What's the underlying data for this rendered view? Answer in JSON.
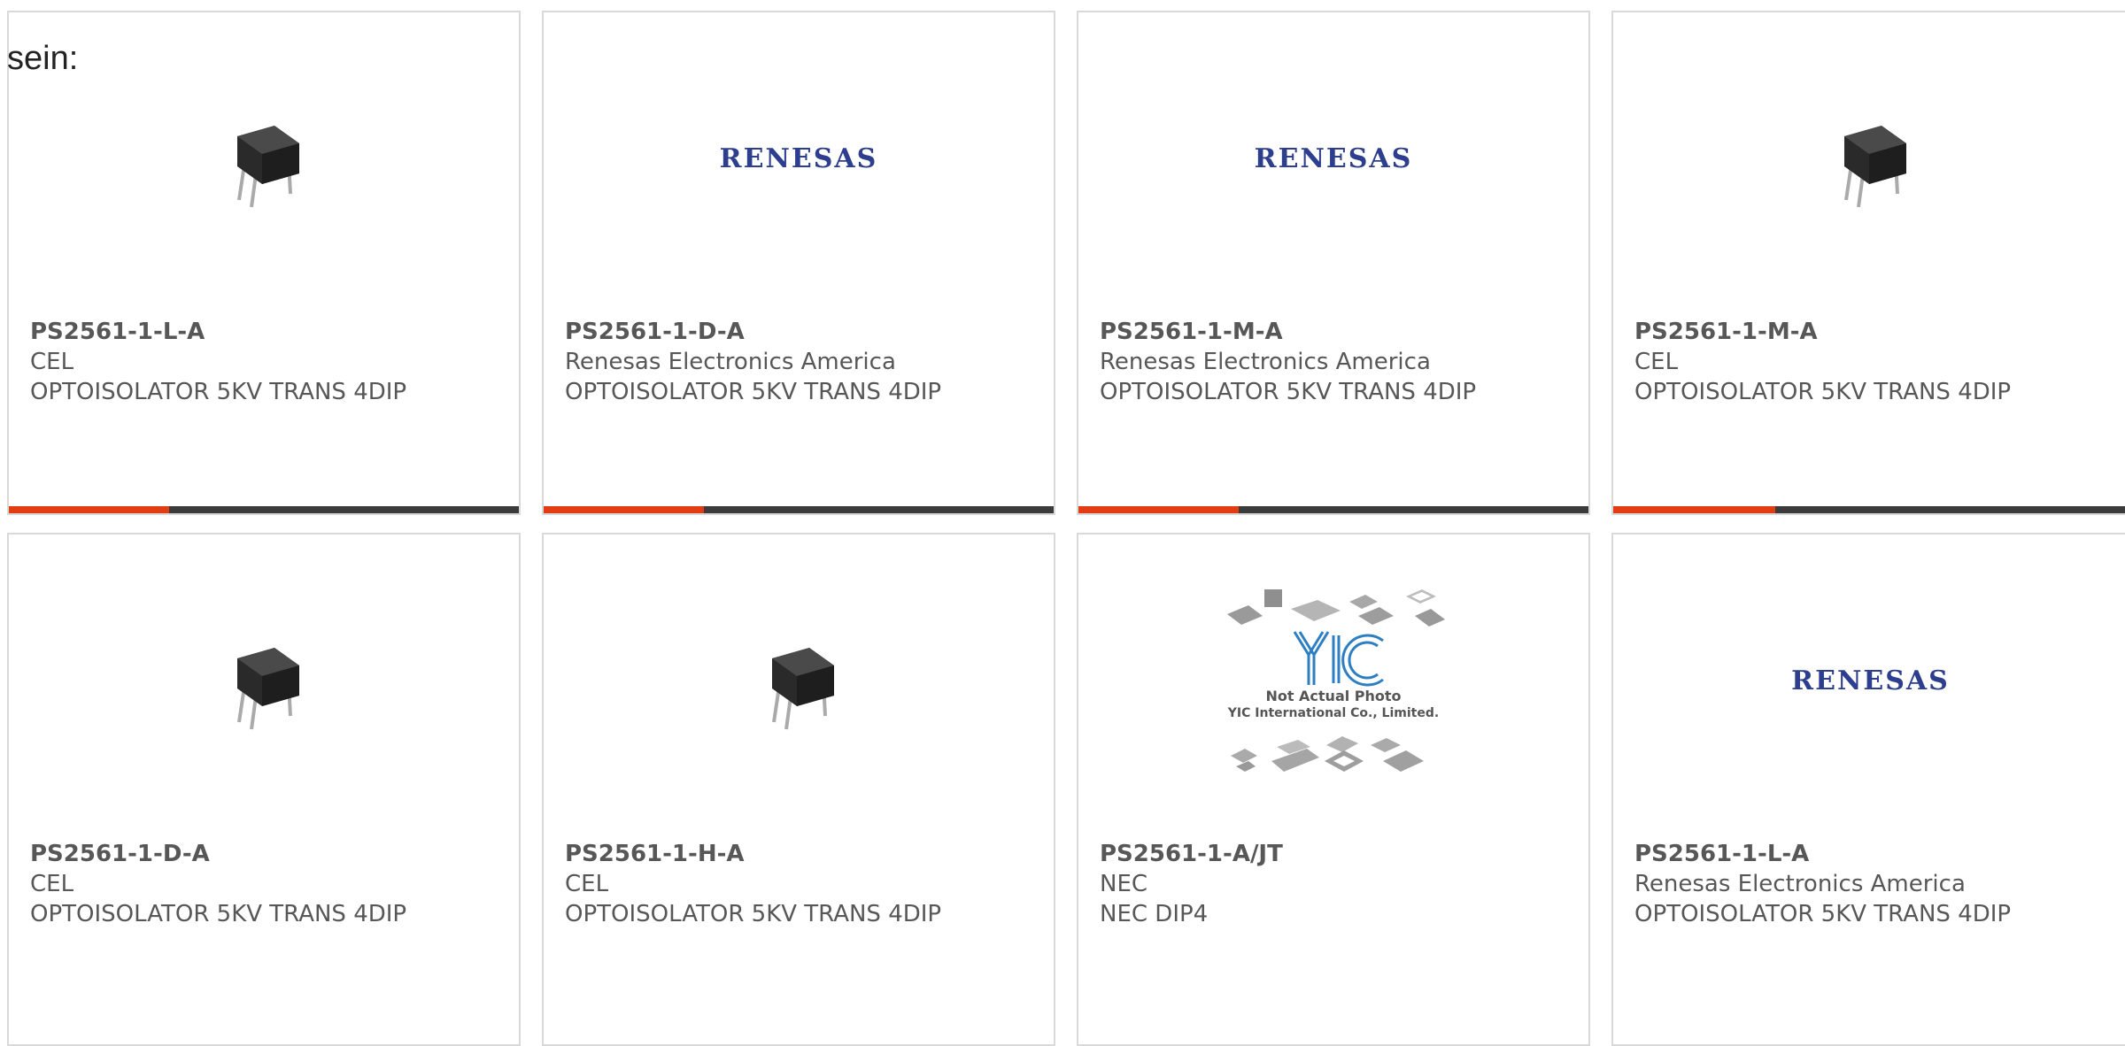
{
  "heading": "sein:",
  "colors": {
    "accent": "#e23d12",
    "bar": "#3b3b3b",
    "renesas_blue": "#2d3e8e",
    "text": "#575757"
  },
  "products": [
    {
      "part_number": "PS2561-1-L-A",
      "manufacturer": "CEL",
      "description": "OPTOISOLATOR 5KV TRANS 4DIP",
      "image": "chip-photo",
      "accent_fraction": 0.315
    },
    {
      "part_number": "PS2561-1-D-A",
      "manufacturer": "Renesas Electronics America",
      "description": "OPTOISOLATOR 5KV TRANS 4DIP",
      "image": "renesas-logo",
      "logo_text": "RENESAS",
      "accent_fraction": 0.315
    },
    {
      "part_number": "PS2561-1-M-A",
      "manufacturer": "Renesas Electronics America",
      "description": "OPTOISOLATOR 5KV TRANS 4DIP",
      "image": "renesas-logo",
      "logo_text": "RENESAS",
      "accent_fraction": 0.315
    },
    {
      "part_number": "PS2561-1-M-A",
      "manufacturer": "CEL",
      "description": "OPTOISOLATOR 5KV TRANS 4DIP",
      "image": "chip-photo",
      "accent_fraction": 0.315
    },
    {
      "part_number": "PS2561-1-D-A",
      "manufacturer": "CEL",
      "description": "OPTOISOLATOR 5KV TRANS 4DIP",
      "image": "chip-photo"
    },
    {
      "part_number": "PS2561-1-H-A",
      "manufacturer": "CEL",
      "description": "OPTOISOLATOR 5KV TRANS 4DIP",
      "image": "chip-photo"
    },
    {
      "part_number": "PS2561-1-A/JT",
      "manufacturer": "NEC",
      "description": "NEC DIP4",
      "image": "not-actual-photo",
      "photo_caption_line1": "Not Actual Photo",
      "photo_caption_line2": "YIC International Co., Limited."
    },
    {
      "part_number": "PS2561-1-L-A",
      "manufacturer": "Renesas Electronics America",
      "description": "OPTOISOLATOR 5KV TRANS 4DIP",
      "image": "renesas-logo",
      "logo_text": "RENESAS"
    }
  ]
}
